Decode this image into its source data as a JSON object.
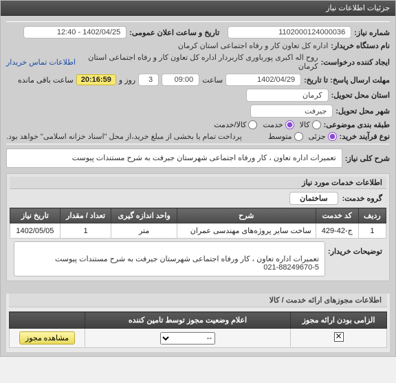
{
  "header": {
    "title": "جزئیات اطلاعات نیاز"
  },
  "need": {
    "number_label": "شماره نیاز:",
    "number": "1102000124000036",
    "ann_label": "تاریخ و ساعت اعلان عمومی:",
    "ann": "1402/04/25 - 12:40",
    "buyer_label": "نام دستگاه خریدار:",
    "buyer": "اداره کل تعاون کار و رفاه اجتماعی استان کرمان",
    "creator_label": "ایجاد کننده درخواست:",
    "creator": "روح اله اکبری پورباوری کاربردار اداره کل تعاون کار و رفاه اجتماعی استان کرمان",
    "contact_link": "اطلاعات تماس خریدار",
    "deadline_label": "مهلت ارسال پاسخ: تا تاریخ:",
    "deadline_date": "1402/04/29",
    "time_label": "ساعت",
    "deadline_time": "09:00",
    "days": "3",
    "days_label": "روز و",
    "countdown": "20:16:59",
    "remain_label": "ساعت باقی مانده",
    "province_label": "استان محل تحویل:",
    "province": "کرمان",
    "city_label": "شهر محل تحویل:",
    "city": "جیرفت",
    "subject_class_label": "طبقه بندی موضوعی:",
    "radio": {
      "kala": "کالا",
      "khadamat": "خدمت",
      "both": "کالا/خدمت"
    },
    "process_label": "نوع فرآیند خرید:",
    "radio2": {
      "low": "جزئی",
      "mid": "متوسط"
    },
    "note": "پرداخت تمام یا بخشی از مبلغ خرید،از محل \"اسناد خزانه اسلامی\" خواهد بود."
  },
  "desc": {
    "title_label": "شرح کلی نیاز:",
    "text": "تعمیرات اداره تعاون ، کار ورفاه اجتماعی شهرستان جیرفت به شرح مستندات پیوست",
    "services_label": "اطلاعات خدمات مورد نیاز",
    "group_label": "گروه خدمت:",
    "group_value": "ساختمان"
  },
  "table": {
    "headers": [
      "ردیف",
      "کد خدمت",
      "شرح",
      "واحد اندازه گیری",
      "تعداد / مقدار",
      "تاریخ نیاز"
    ],
    "rows": [
      [
        "1",
        "ج-42-429",
        "ساخت سایر پروژه‌های مهندسی عمران",
        "متر",
        "1",
        "1402/05/05"
      ]
    ]
  },
  "buyer_notes": {
    "label": "توضیحات خریدار:",
    "text": "تعمیرات اداره تعاون ، کار ورفاه اجتماعی شهرستان جیرفت به شرح مستندات پیوست\n021-88249670-5"
  },
  "permits": {
    "section_label": "اطلاعات مجوزهای ارائه خدمت / کالا",
    "headers": [
      "الزامی بودن ارائه مجوز",
      "اعلام وضعیت مجوز توسط تامین کننده",
      ""
    ],
    "row": {
      "mandatory_checked": true,
      "status_placeholder": "--",
      "view_btn": "مشاهده مجوز"
    }
  }
}
